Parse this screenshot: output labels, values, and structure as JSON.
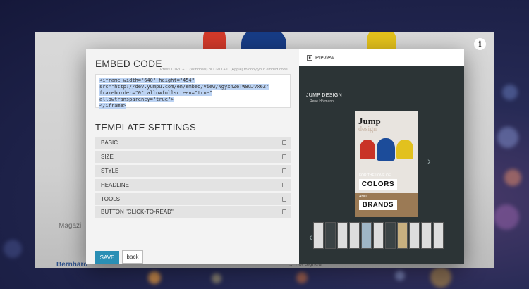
{
  "background_text": {
    "magazine_label": "Magazi",
    "author_label": "Bernhard",
    "partial_text": "... not signed"
  },
  "embed": {
    "title": "EMBED CODE",
    "hint": "Press CTRL + C (Windows) or CMD + C (Apple) to copy your embed code",
    "code_line1": "<iframe width=\"640\" height=\"454\"",
    "code_line2": "src=\"http://dev.yumpu.com/en/embed/view/Ngyx4ZeTW8uJVx62\"",
    "code_line3": "frameborder=\"0\"  allowfullscreen=\"true\" allowtransparency=\"true\">",
    "code_line4": "</iframe>"
  },
  "template": {
    "title": "TEMPLATE SETTINGS",
    "rows": [
      {
        "label": "BASIC"
      },
      {
        "label": "SIZE"
      },
      {
        "label": "STYLE"
      },
      {
        "label": "HEADLINE"
      },
      {
        "label": "TOOLS"
      },
      {
        "label": "BUTTON \"CLICK-TO-READ\""
      }
    ]
  },
  "actions": {
    "save": "SAVE",
    "back": "back"
  },
  "preview": {
    "label": "Preview",
    "magazine_title": "JUMP DESIGN",
    "magazine_author": "Rene Hörmann",
    "cover_logo": "Jump",
    "cover_logo_sub": "design",
    "cover_tag_top": "FOR THE LOVE OF",
    "cover_word1": "COLORS",
    "cover_word2": "AND",
    "cover_word3": "BRANDS"
  },
  "colors": {
    "save_button": "#2a8fb5",
    "preview_bg": "#2c3436",
    "highlight": "#bcd3f3"
  }
}
